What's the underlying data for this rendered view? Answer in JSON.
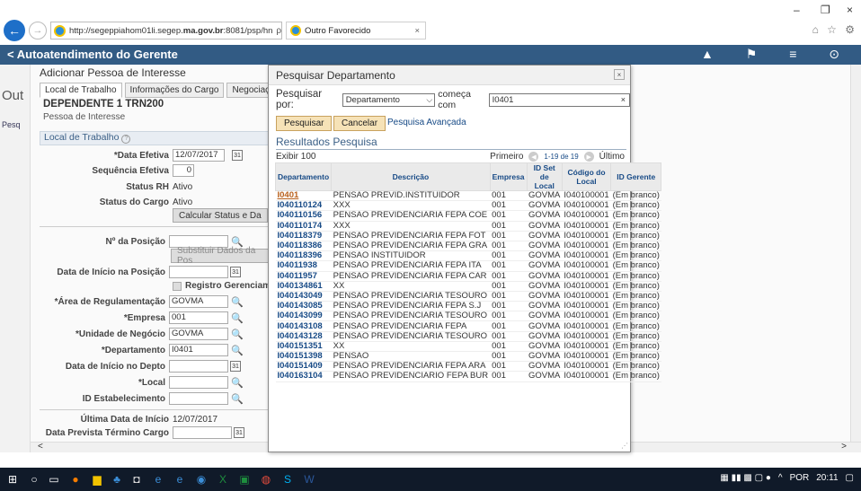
{
  "browser": {
    "url_prefix": "http://segeppiahom01li.segep.",
    "url_bold": "ma.gov.br",
    "url_suffix": ":8081/psp/hn",
    "addr_tools": "ρ ▾ Ċ",
    "tab_title": "Outro Favorecido",
    "tab_close": "×",
    "win_min": "–",
    "win_max": "❐",
    "win_close": "×",
    "toolbar_icons": "⌂ ☆ ⚙"
  },
  "app": {
    "back_chevron": "<",
    "title": "Autoatendimento do Gerente",
    "header_icons": "▲ ⚑ ≡ ⊙"
  },
  "page": {
    "left_title": "Out",
    "left_sub": "Pesq",
    "header": "Adicionar Pessoa de Interesse",
    "tabs": [
      "Local de Trabalho",
      "Informações do Cargo",
      "Negociações Tra"
    ],
    "dep_title": "DEPENDENTE 1 TRN200",
    "dep_sub": "Pessoa de Interesse",
    "section": "Local de Trabalho",
    "help_icon": "?",
    "fields": {
      "data_efetiva_lbl": "*Data Efetiva",
      "data_efetiva": "12/07/2017",
      "seq_lbl": "Sequência Efetiva",
      "seq": "0",
      "status_rh_lbl": "Status RH",
      "status_rh": "Ativo",
      "status_cargo_lbl": "Status do Cargo",
      "status_cargo": "Ativo",
      "calc_btn": "Calcular Status e Da",
      "posicao_lbl": "Nº da Posição",
      "subst_btn": "Substituir Dados da Pos",
      "inicio_pos_lbl": "Data de Início na Posição",
      "registro_lbl": "Registro Gerenciament",
      "area_lbl": "*Área de Regulamentação",
      "area": "GOVMA",
      "empresa_lbl": "*Empresa",
      "empresa": "001",
      "unidade_lbl": "*Unidade de Negócio",
      "unidade": "GOVMA",
      "depto_lbl": "*Departamento",
      "depto": "I0401",
      "inicio_depto_lbl": "Data de Início no Depto",
      "local_lbl": "*Local",
      "estab_lbl": "ID Estabelecimento",
      "ultima_lbl": "Última Data de Início",
      "ultima": "12/07/2017",
      "prevista_lbl": "Data Prevista Término Cargo"
    },
    "calendar_glyph": "31",
    "magnifier_glyph": "🔍",
    "scroll_left": "<",
    "scroll_right": ">"
  },
  "modal": {
    "title": "Pesquisar Departamento",
    "close": "×",
    "search_label": "Pesquisar por:",
    "search_field": "Departamento",
    "operator": "começa com",
    "search_value": "I0401",
    "clear_x": "×",
    "btn_search": "Pesquisar",
    "btn_cancel": "Cancelar",
    "advanced": "Pesquisa Avançada",
    "results_title": "Resultados Pesquisa",
    "show": "Exibir 100",
    "pager_first": "Primeiro",
    "pager_range": "1-19 de 19",
    "pager_last": "Último",
    "columns": [
      "Departamento",
      "Descrição",
      "Empresa",
      "ID Set de Local",
      "Código do Local",
      "ID Gerente"
    ],
    "rows": [
      [
        "I0401",
        "PENSAO PREVID.INSTITUIDOR",
        "001",
        "GOVMA",
        "I040100001",
        "(Em branco)"
      ],
      [
        "I040110124",
        "XXX",
        "001",
        "GOVMA",
        "I040100001",
        "(Em branco)"
      ],
      [
        "I040110156",
        "PENSAO PREVIDENCIARIA FEPA COE",
        "001",
        "GOVMA",
        "I040100001",
        "(Em branco)"
      ],
      [
        "I040110174",
        "XXX",
        "001",
        "GOVMA",
        "I040100001",
        "(Em branco)"
      ],
      [
        "I040118379",
        "PENSAO PREVIDENCIARIA FEPA FOT",
        "001",
        "GOVMA",
        "I040100001",
        "(Em branco)"
      ],
      [
        "I040118386",
        "PENSAO PREVIDENCIARIA FEPA GRA",
        "001",
        "GOVMA",
        "I040100001",
        "(Em branco)"
      ],
      [
        "I040118396",
        "PENSAO INSTITUIDOR",
        "001",
        "GOVMA",
        "I040100001",
        "(Em branco)"
      ],
      [
        "I04011938",
        "PENSAO PREVIDENCIARIA FEPA ITA",
        "001",
        "GOVMA",
        "I040100001",
        "(Em branco)"
      ],
      [
        "I04011957",
        "PENSAO PREVIDENCIARIA FEPA CAR",
        "001",
        "GOVMA",
        "I040100001",
        "(Em branco)"
      ],
      [
        "I040134861",
        "XX",
        "001",
        "GOVMA",
        "I040100001",
        "(Em branco)"
      ],
      [
        "I040143049",
        "PENSAO PREVIDENCIARIA TESOURO",
        "001",
        "GOVMA",
        "I040100001",
        "(Em branco)"
      ],
      [
        "I040143085",
        "PENSAO PREVIDENCIARIA FEPA S.J",
        "001",
        "GOVMA",
        "I040100001",
        "(Em branco)"
      ],
      [
        "I040143099",
        "PENSAO PREVIDENCIARIA TESOURO",
        "001",
        "GOVMA",
        "I040100001",
        "(Em branco)"
      ],
      [
        "I040143108",
        "PENSAO PREVIDENCIARIA FEPA",
        "001",
        "GOVMA",
        "I040100001",
        "(Em branco)"
      ],
      [
        "I040143128",
        "PENSAO PREVIDENCIARIA TESOURO",
        "001",
        "GOVMA",
        "I040100001",
        "(Em branco)"
      ],
      [
        "I040151351",
        "XX",
        "001",
        "GOVMA",
        "I040100001",
        "(Em branco)"
      ],
      [
        "I040151398",
        "PENSAO",
        "001",
        "GOVMA",
        "I040100001",
        "(Em branco)"
      ],
      [
        "I040151409",
        "PENSAO PREVIDENCIARIA FEPA ARA",
        "001",
        "GOVMA",
        "I040100001",
        "(Em branco)"
      ],
      [
        "I040163104",
        "PENSAO PREVIDENCIARIO FEPA BUR",
        "001",
        "GOVMA",
        "I040100001",
        "(Em branco)"
      ]
    ]
  },
  "taskbar": {
    "language": "POR",
    "time": "20:11"
  },
  "colors": {
    "app_header": "#325b84",
    "link": "#174a86",
    "button_bg": "#f6e2b7",
    "taskbar": "#101a29"
  }
}
